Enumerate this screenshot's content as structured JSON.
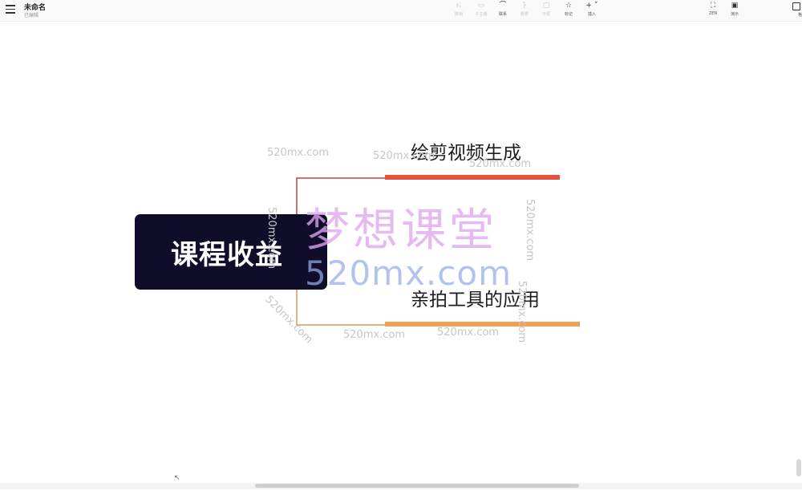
{
  "header": {
    "title": "未命名",
    "status": "已编辑"
  },
  "toolbar": {
    "undo": {
      "label": "撤销",
      "icon": "undo-icon",
      "enabled": false
    },
    "subtopic": {
      "label": "子主题",
      "icon": "subtopic-icon",
      "enabled": false
    },
    "relation": {
      "label": "联系",
      "icon": "relation-icon",
      "enabled": true
    },
    "summary": {
      "label": "概要",
      "icon": "summary-icon",
      "enabled": false
    },
    "frame": {
      "label": "外框",
      "icon": "frame-icon",
      "enabled": false
    },
    "marker": {
      "label": "标记",
      "icon": "star-icon",
      "enabled": true
    },
    "insert": {
      "label": "插入",
      "icon": "plus-icon",
      "enabled": true
    },
    "zen": {
      "label": "ZEN",
      "icon": "fullscreen-icon",
      "enabled": true
    },
    "present": {
      "label": "演示",
      "icon": "play-icon",
      "enabled": true
    },
    "format": {
      "label": "格",
      "icon": "format-panel-icon",
      "enabled": true
    }
  },
  "mindmap": {
    "root": "课程收益",
    "branches": [
      {
        "label": "绘剪视频生成",
        "color": "#e8503f"
      },
      {
        "label": "亲拍工具的应用",
        "color": "#f0a052"
      }
    ]
  },
  "watermark": {
    "main_cn": "梦想课堂",
    "main_en": "520mx.com",
    "small": "520mx.com"
  },
  "colors": {
    "root_fill": "#0f0d2a",
    "connector_top": "#c0453c",
    "connector_bottom": "#d49a5e"
  }
}
